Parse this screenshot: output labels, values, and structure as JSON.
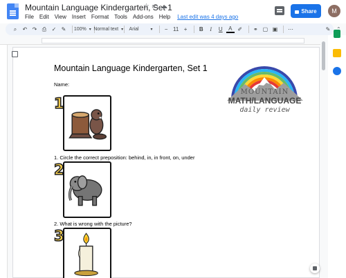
{
  "app": {
    "title": "Mountain Language Kindergarten, Set 1",
    "menu": [
      "File",
      "Edit",
      "View",
      "Insert",
      "Format",
      "Tools",
      "Add-ons",
      "Help"
    ],
    "last_edit": "Last edit was 4 days ago",
    "share_label": "Share",
    "avatar_initial": "M"
  },
  "toolbar": {
    "zoom": "100%",
    "style": "Normal text",
    "font": "Arial",
    "font_size": "11",
    "bold": "B",
    "italic": "I",
    "underline": "U",
    "text_color": "A"
  },
  "document": {
    "heading": "Mountain Language Kindergarten, Set 1",
    "name_label": "Name:",
    "q1": "1. Circle the correct preposition: behind, in, in front, on, under",
    "q2": "2. What is wrong with the picture?",
    "numbers": [
      "1",
      "2",
      "3"
    ],
    "logo_line1": "MOUNTAIN",
    "logo_line2": "MATH/LANGUAGE",
    "logo_line3": "daily review"
  },
  "colors": {
    "accent": "#1a73e8",
    "docs_blue": "#4285f4",
    "number_fill": "#ffd54f"
  }
}
